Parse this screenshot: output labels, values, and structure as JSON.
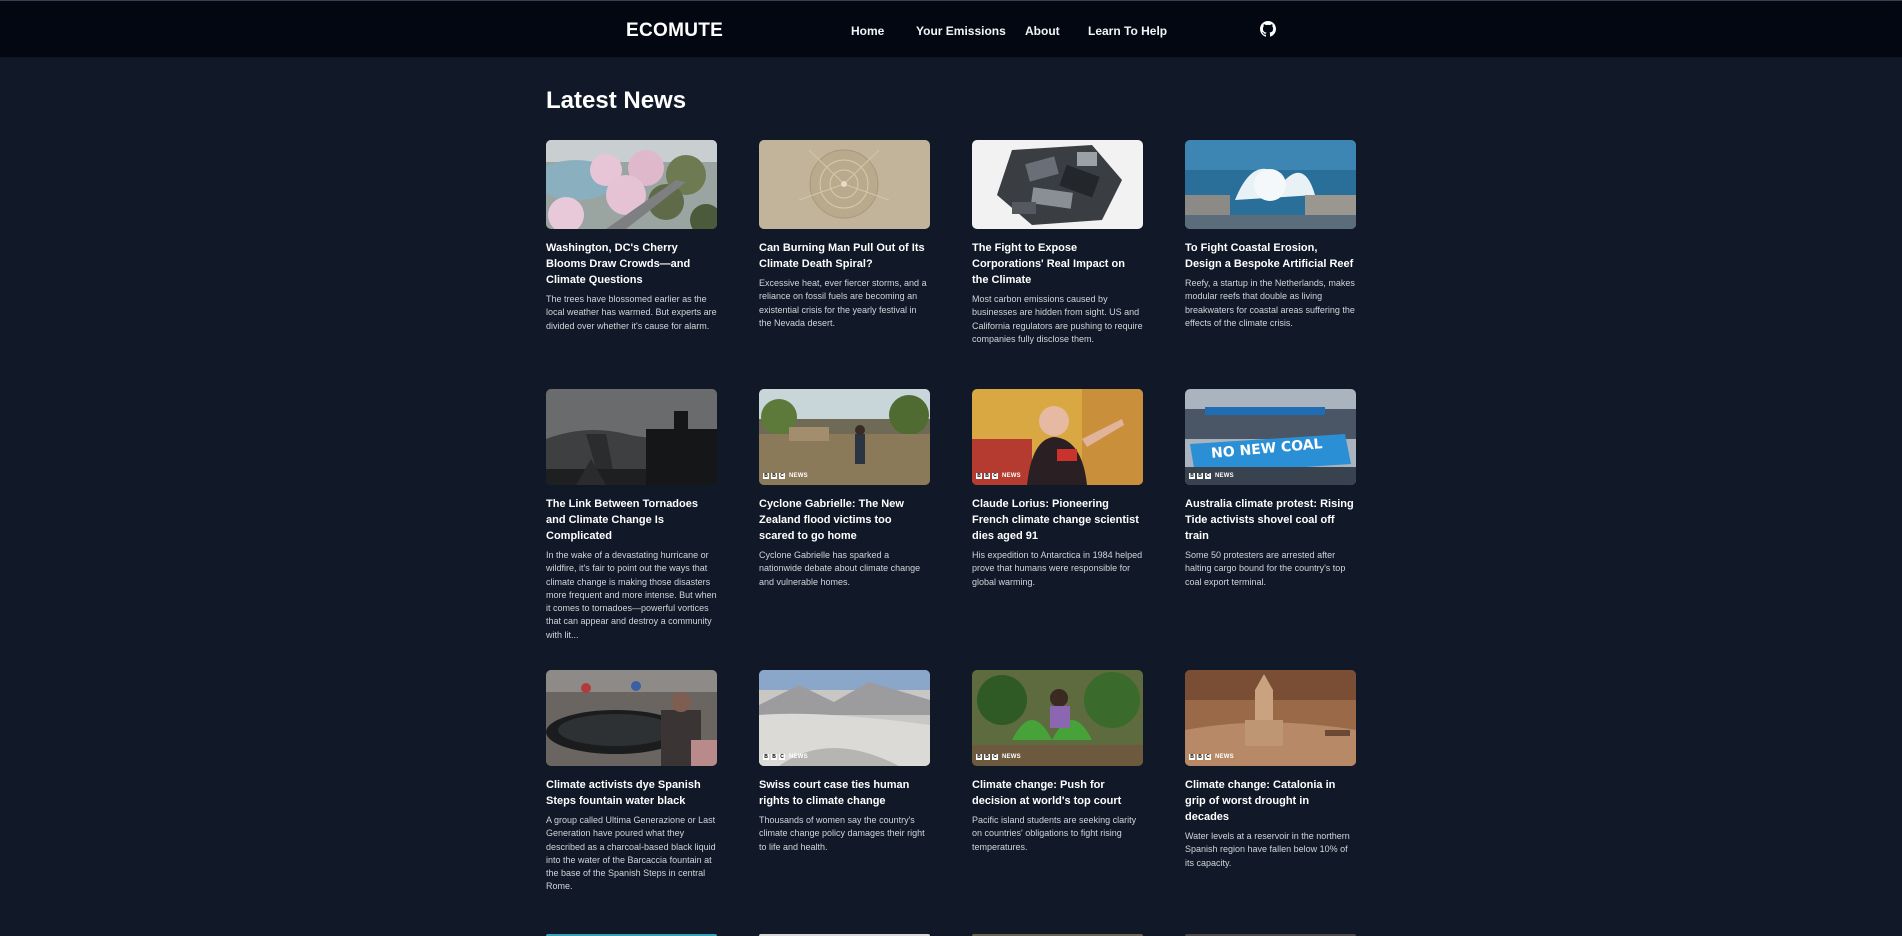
{
  "nav": {
    "brand": "ECOMUTE",
    "links": [
      "Home",
      "Your Emissions",
      "About",
      "Learn To Help"
    ],
    "github_icon": "github-icon"
  },
  "page": {
    "heading": "Latest News"
  },
  "colors": {
    "background": "#111827",
    "navbar": "#030712",
    "text": "#ffffff",
    "muted_text": "#d1d5db"
  },
  "articles": [
    {
      "title": "Washington, DC's Cherry Blooms Draw Crowds—and Climate Questions",
      "description": "The trees have blossomed earlier as the local weather has warmed. But experts are divided over whether it's cause for alarm.",
      "bbc_news": false
    },
    {
      "title": "Can Burning Man Pull Out of Its Climate Death Spiral?",
      "description": "Excessive heat, ever fiercer storms, and a reliance on fossil fuels are becoming an existential crisis for the yearly festival in the Nevada desert.",
      "bbc_news": false
    },
    {
      "title": "The Fight to Expose Corporations' Real Impact on the Climate",
      "description": "Most carbon emissions caused by businesses are hidden from sight. US and California regulators are pushing to require companies fully disclose them.",
      "bbc_news": false
    },
    {
      "title": "To Fight Coastal Erosion, Design a Bespoke Artificial Reef",
      "description": "Reefy, a startup in the Netherlands, makes modular reefs that double as living breakwaters for coastal areas suffering the effects of the climate crisis.",
      "bbc_news": false
    },
    {
      "title": "The Link Between Tornadoes and Climate Change Is Complicated",
      "description": "In the wake of a devastating hurricane or wildfire, it's fair to point out the ways that climate change is making those disasters more frequent and more intense. But when it comes to tornadoes—powerful vortices that can appear and destroy a community with lit...",
      "bbc_news": false
    },
    {
      "title": "Cyclone Gabrielle: The New Zealand flood victims too scared to go home",
      "description": "Cyclone Gabrielle has sparked a nationwide debate about climate change and vulnerable homes.",
      "bbc_news": true
    },
    {
      "title": "Claude Lorius: Pioneering French climate change scientist dies aged 91",
      "description": "His expedition to Antarctica in 1984 helped prove that humans were responsible for global warming.",
      "bbc_news": true
    },
    {
      "title": "Australia climate protest: Rising Tide activists shovel coal off train",
      "description": "Some 50 protesters are arrested after halting cargo bound for the country's top coal export terminal.",
      "bbc_news": true
    },
    {
      "title": "Climate activists dye Spanish Steps fountain water black",
      "description": "A group called Ultima Generazione or Last Generation have poured what they described as a charcoal-based black liquid into the water of the Barcaccia fountain at the base of the Spanish Steps in central Rome.",
      "bbc_news": false
    },
    {
      "title": "Swiss court case ties human rights to climate change",
      "description": "Thousands of women say the country's climate change policy damages their right to life and health.",
      "bbc_news": true
    },
    {
      "title": "Climate change: Push for decision at world's top court",
      "description": "Pacific island students are seeking clarity on countries' obligations to fight rising temperatures.",
      "bbc_news": true
    },
    {
      "title": "Climate change: Catalonia in grip of worst drought in decades",
      "description": "Water levels at a reservoir in the northern Spanish region have fallen below 10% of its capacity.",
      "bbc_news": true
    }
  ],
  "bbc_label": {
    "box": "B",
    "word": "NEWS"
  },
  "banner_text": "NO NEW COAL"
}
